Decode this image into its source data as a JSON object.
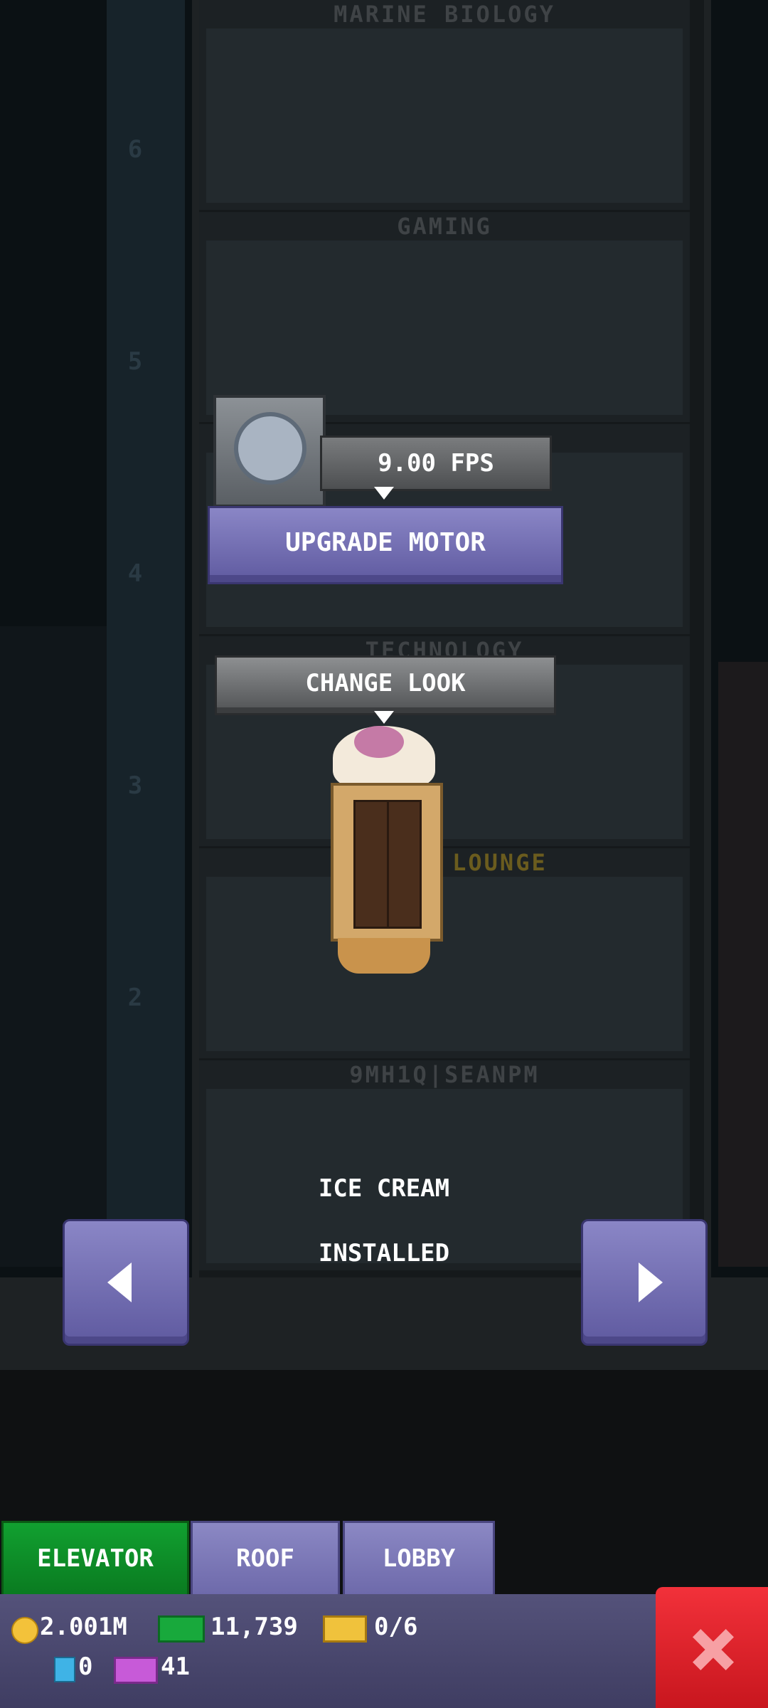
{
  "floors": [
    {
      "name": "MARINE BIOLOGY",
      "number": "6"
    },
    {
      "name": "GAMING",
      "number": "5"
    },
    {
      "name": "",
      "number": "4"
    },
    {
      "name": "TECHNOLOGY",
      "number": "3"
    },
    {
      "name": "LEGEND LOUNGE",
      "number": "2"
    },
    {
      "name": "9MH1Q|SEANPM",
      "number": ""
    }
  ],
  "motor": {
    "fps": "9.00 FPS",
    "upgrade_label": "UPGRADE MOTOR",
    "icon": "motor-wheel-icon"
  },
  "look": {
    "change_label": "CHANGE LOOK",
    "style_name": "ICE CREAM",
    "status": "INSTALLED"
  },
  "tabs": [
    {
      "label": "ELEVATOR",
      "active": true
    },
    {
      "label": "ROOF",
      "active": false
    },
    {
      "label": "LOBBY",
      "active": false
    }
  ],
  "resources": {
    "coins": "2.001M",
    "bux": "11,739",
    "tickets": "0/6",
    "cubes": "0",
    "vip": "41"
  },
  "colors": {
    "active_tab": "#0f8f28",
    "purple_button": "#6f6bb0",
    "close_button": "#e0242c",
    "status_bar": "#4a4870"
  }
}
